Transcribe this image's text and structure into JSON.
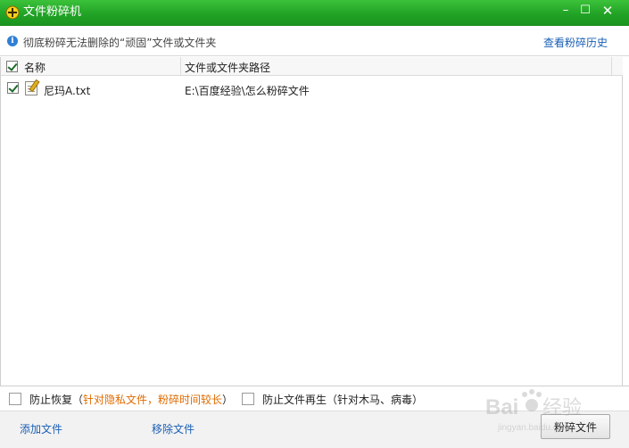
{
  "window": {
    "title": "文件粉碎机",
    "minimize": "–",
    "maximize": "☐",
    "close": "✕"
  },
  "info": {
    "text": "彻底粉碎无法删除的“顽固”文件或文件夹",
    "history_link": "查看粉碎历史"
  },
  "table": {
    "columns": [
      "名称",
      "文件或文件夹路径"
    ],
    "header_checked": true,
    "rows": [
      {
        "checked": true,
        "name": "尼玛A.txt",
        "path": "E:\\百度经验\\怎么粉碎文件"
      }
    ]
  },
  "options": {
    "prevent_recovery": {
      "checked": false,
      "label": "防止恢复",
      "note_open": "（",
      "note": "针对隐私文件，粉碎时间较长",
      "note_close": "）"
    },
    "prevent_regeneration": {
      "checked": false,
      "label": "防止文件再生（针对木马、病毒）"
    }
  },
  "bottom": {
    "add_file": "添加文件",
    "remove_file": "移除文件",
    "shred_button": "粉碎文件"
  },
  "watermark": {
    "logo_text": "Bai",
    "logo_cn": "经验",
    "url": "jingyan.baidu.com"
  },
  "colors": {
    "title_green": "#22a326",
    "link_blue": "#1a5fb4",
    "note_orange": "#e06b00"
  }
}
